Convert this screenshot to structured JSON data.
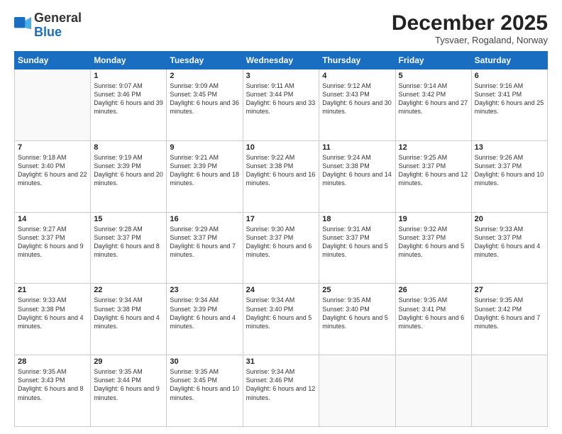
{
  "header": {
    "logo": {
      "general": "General",
      "blue": "Blue"
    },
    "month": "December 2025",
    "location": "Tysvaer, Rogaland, Norway"
  },
  "weekdays": [
    "Sunday",
    "Monday",
    "Tuesday",
    "Wednesday",
    "Thursday",
    "Friday",
    "Saturday"
  ],
  "weeks": [
    [
      {
        "day": null
      },
      {
        "day": "1",
        "sunrise": "9:07 AM",
        "sunset": "3:46 PM",
        "daylight": "6 hours and 39 minutes."
      },
      {
        "day": "2",
        "sunrise": "9:09 AM",
        "sunset": "3:45 PM",
        "daylight": "6 hours and 36 minutes."
      },
      {
        "day": "3",
        "sunrise": "9:11 AM",
        "sunset": "3:44 PM",
        "daylight": "6 hours and 33 minutes."
      },
      {
        "day": "4",
        "sunrise": "9:12 AM",
        "sunset": "3:43 PM",
        "daylight": "6 hours and 30 minutes."
      },
      {
        "day": "5",
        "sunrise": "9:14 AM",
        "sunset": "3:42 PM",
        "daylight": "6 hours and 27 minutes."
      },
      {
        "day": "6",
        "sunrise": "9:16 AM",
        "sunset": "3:41 PM",
        "daylight": "6 hours and 25 minutes."
      }
    ],
    [
      {
        "day": "7",
        "sunrise": "9:18 AM",
        "sunset": "3:40 PM",
        "daylight": "6 hours and 22 minutes."
      },
      {
        "day": "8",
        "sunrise": "9:19 AM",
        "sunset": "3:39 PM",
        "daylight": "6 hours and 20 minutes."
      },
      {
        "day": "9",
        "sunrise": "9:21 AM",
        "sunset": "3:39 PM",
        "daylight": "6 hours and 18 minutes."
      },
      {
        "day": "10",
        "sunrise": "9:22 AM",
        "sunset": "3:38 PM",
        "daylight": "6 hours and 16 minutes."
      },
      {
        "day": "11",
        "sunrise": "9:24 AM",
        "sunset": "3:38 PM",
        "daylight": "6 hours and 14 minutes."
      },
      {
        "day": "12",
        "sunrise": "9:25 AM",
        "sunset": "3:37 PM",
        "daylight": "6 hours and 12 minutes."
      },
      {
        "day": "13",
        "sunrise": "9:26 AM",
        "sunset": "3:37 PM",
        "daylight": "6 hours and 10 minutes."
      }
    ],
    [
      {
        "day": "14",
        "sunrise": "9:27 AM",
        "sunset": "3:37 PM",
        "daylight": "6 hours and 9 minutes."
      },
      {
        "day": "15",
        "sunrise": "9:28 AM",
        "sunset": "3:37 PM",
        "daylight": "6 hours and 8 minutes."
      },
      {
        "day": "16",
        "sunrise": "9:29 AM",
        "sunset": "3:37 PM",
        "daylight": "6 hours and 7 minutes."
      },
      {
        "day": "17",
        "sunrise": "9:30 AM",
        "sunset": "3:37 PM",
        "daylight": "6 hours and 6 minutes."
      },
      {
        "day": "18",
        "sunrise": "9:31 AM",
        "sunset": "3:37 PM",
        "daylight": "6 hours and 5 minutes."
      },
      {
        "day": "19",
        "sunrise": "9:32 AM",
        "sunset": "3:37 PM",
        "daylight": "6 hours and 5 minutes."
      },
      {
        "day": "20",
        "sunrise": "9:33 AM",
        "sunset": "3:37 PM",
        "daylight": "6 hours and 4 minutes."
      }
    ],
    [
      {
        "day": "21",
        "sunrise": "9:33 AM",
        "sunset": "3:38 PM",
        "daylight": "6 hours and 4 minutes."
      },
      {
        "day": "22",
        "sunrise": "9:34 AM",
        "sunset": "3:38 PM",
        "daylight": "6 hours and 4 minutes."
      },
      {
        "day": "23",
        "sunrise": "9:34 AM",
        "sunset": "3:39 PM",
        "daylight": "6 hours and 4 minutes."
      },
      {
        "day": "24",
        "sunrise": "9:34 AM",
        "sunset": "3:40 PM",
        "daylight": "6 hours and 5 minutes."
      },
      {
        "day": "25",
        "sunrise": "9:35 AM",
        "sunset": "3:40 PM",
        "daylight": "6 hours and 5 minutes."
      },
      {
        "day": "26",
        "sunrise": "9:35 AM",
        "sunset": "3:41 PM",
        "daylight": "6 hours and 6 minutes."
      },
      {
        "day": "27",
        "sunrise": "9:35 AM",
        "sunset": "3:42 PM",
        "daylight": "6 hours and 7 minutes."
      }
    ],
    [
      {
        "day": "28",
        "sunrise": "9:35 AM",
        "sunset": "3:43 PM",
        "daylight": "6 hours and 8 minutes."
      },
      {
        "day": "29",
        "sunrise": "9:35 AM",
        "sunset": "3:44 PM",
        "daylight": "6 hours and 9 minutes."
      },
      {
        "day": "30",
        "sunrise": "9:35 AM",
        "sunset": "3:45 PM",
        "daylight": "6 hours and 10 minutes."
      },
      {
        "day": "31",
        "sunrise": "9:34 AM",
        "sunset": "3:46 PM",
        "daylight": "6 hours and 12 minutes."
      },
      {
        "day": null
      },
      {
        "day": null
      },
      {
        "day": null
      }
    ]
  ]
}
